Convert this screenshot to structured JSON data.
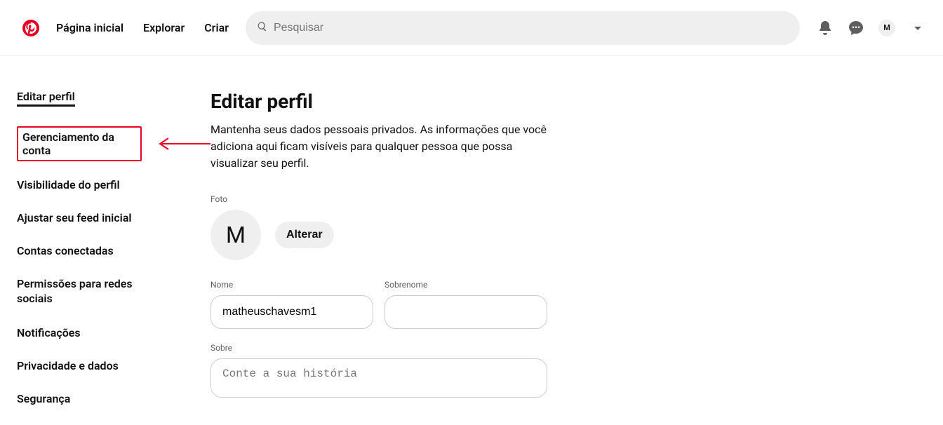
{
  "nav": {
    "home": "Página inicial",
    "explore": "Explorar",
    "create": "Criar"
  },
  "search": {
    "placeholder": "Pesquisar"
  },
  "avatar_initial": "M",
  "sidebar": {
    "items": [
      "Editar perfil",
      "Gerenciamento da conta",
      "Visibilidade do perfil",
      "Ajustar seu feed inicial",
      "Contas conectadas",
      "Permissões para redes sociais",
      "Notificações",
      "Privacidade e dados",
      "Segurança"
    ]
  },
  "main": {
    "title": "Editar perfil",
    "description": "Mantenha seus dados pessoais privados. As informações que você adiciona aqui ficam visíveis para qualquer pessoa que possa visualizar seu perfil.",
    "photo_label": "Foto",
    "avatar_initial": "M",
    "change_btn": "Alterar",
    "name_label": "Nome",
    "surname_label": "Sobrenome",
    "name_value": "matheuschavesm1",
    "surname_value": "",
    "about_label": "Sobre",
    "about_placeholder": "Conte a sua história"
  }
}
